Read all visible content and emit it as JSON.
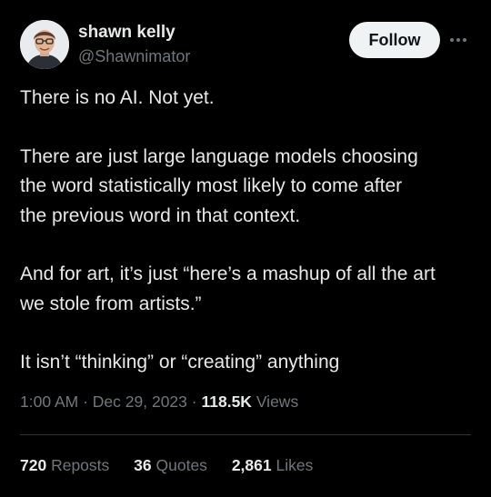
{
  "author": {
    "display_name": "shawn kelly",
    "handle": "@Shawnimator",
    "avatar_icon": "person-avatar"
  },
  "actions": {
    "follow_label": "Follow",
    "more_icon": "ellipsis-icon"
  },
  "tweet": {
    "paragraphs": [
      "There is no AI. Not yet.",
      "There are just large language models choosing\nthe word statistically most likely to come after\nthe previous word in that context.",
      "And for art, it’s just “here’s a mashup of all the art\nwe stole from artists.”",
      "It isn’t “thinking” or “creating” anything"
    ]
  },
  "meta": {
    "time": "1:00 AM",
    "date": "Dec 29, 2023",
    "separator": "·",
    "views_count": "118.5K",
    "views_label": "Views"
  },
  "stats": [
    {
      "count": "720",
      "label": "Reposts"
    },
    {
      "count": "36",
      "label": "Quotes"
    },
    {
      "count": "2,861",
      "label": "Likes"
    }
  ],
  "colors": {
    "background": "#000000",
    "text_primary": "#e7e9ea",
    "text_secondary": "#71767b",
    "button_bg": "#eff3f4",
    "divider": "#2f3336"
  }
}
